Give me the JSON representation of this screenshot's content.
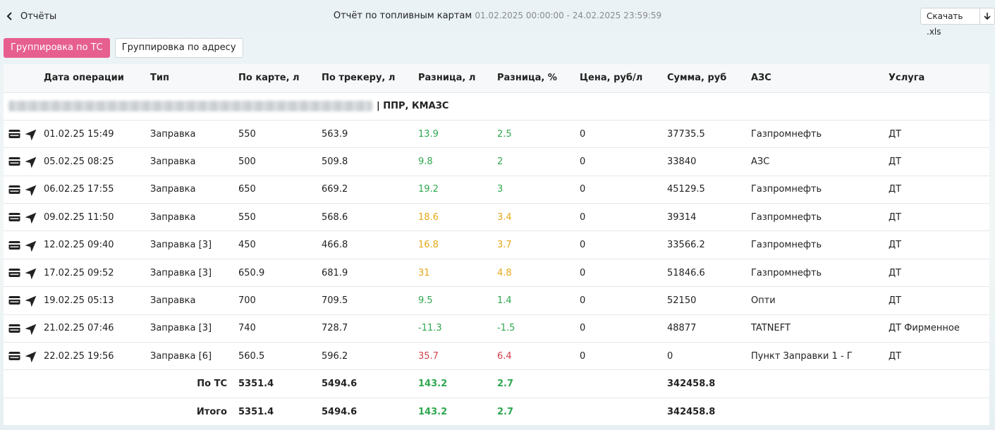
{
  "header": {
    "back_label": "Отчёты",
    "title": "Отчёт по топливным картам",
    "period": "01.02.2025 00:00:00 - 24.02.2025 23:59:59",
    "download_label": "Скачать .xls"
  },
  "tabs": [
    {
      "label": "Группировка по ТС",
      "active": true
    },
    {
      "label": "Группировка по адресу",
      "active": false
    }
  ],
  "table": {
    "columns": [
      "Дата операции",
      "Тип",
      "По карте, л",
      "По трекеру, л",
      "Разница, л",
      "Разница, %",
      "Цена, руб/л",
      "Сумма, руб",
      "АЗС",
      "Услуга"
    ],
    "group_label": "| ППР, КМАЗС",
    "rows": [
      {
        "date": "01.02.25 15:49",
        "type": "Заправка",
        "card": "550",
        "tracker": "563.9",
        "diff_l": "13.9",
        "diff_pct": "2.5",
        "price": "0",
        "sum": "37735.5",
        "station": "Газпромнефть",
        "service": "ДТ",
        "status": "green"
      },
      {
        "date": "05.02.25 08:25",
        "type": "Заправка",
        "card": "500",
        "tracker": "509.8",
        "diff_l": "9.8",
        "diff_pct": "2",
        "price": "0",
        "sum": "33840",
        "station": "АЗС",
        "service": "ДТ",
        "status": "green"
      },
      {
        "date": "06.02.25 17:55",
        "type": "Заправка",
        "card": "650",
        "tracker": "669.2",
        "diff_l": "19.2",
        "diff_pct": "3",
        "price": "0",
        "sum": "45129.5",
        "station": "Газпромнефть",
        "service": "ДТ",
        "status": "green"
      },
      {
        "date": "09.02.25 11:50",
        "type": "Заправка",
        "card": "550",
        "tracker": "568.6",
        "diff_l": "18.6",
        "diff_pct": "3.4",
        "price": "0",
        "sum": "39314",
        "station": "Газпромнефть",
        "service": "ДТ",
        "status": "amber"
      },
      {
        "date": "12.02.25 09:40",
        "type": "Заправка [3]",
        "card": "450",
        "tracker": "466.8",
        "diff_l": "16.8",
        "diff_pct": "3.7",
        "price": "0",
        "sum": "33566.2",
        "station": "Газпромнефть",
        "service": "ДТ",
        "status": "amber"
      },
      {
        "date": "17.02.25 09:52",
        "type": "Заправка [3]",
        "card": "650.9",
        "tracker": "681.9",
        "diff_l": "31",
        "diff_pct": "4.8",
        "price": "0",
        "sum": "51846.6",
        "station": "Газпромнефть",
        "service": "ДТ",
        "status": "amber"
      },
      {
        "date": "19.02.25 05:13",
        "type": "Заправка",
        "card": "700",
        "tracker": "709.5",
        "diff_l": "9.5",
        "diff_pct": "1.4",
        "price": "0",
        "sum": "52150",
        "station": "Опти",
        "service": "ДТ",
        "status": "green"
      },
      {
        "date": "21.02.25 07:46",
        "type": "Заправка [3]",
        "card": "740",
        "tracker": "728.7",
        "diff_l": "-11.3",
        "diff_pct": "-1.5",
        "price": "0",
        "sum": "48877",
        "station": "TATNEFT",
        "service": "ДТ Фирменное",
        "status": "green"
      },
      {
        "date": "22.02.25 19:56",
        "type": "Заправка [6]",
        "card": "560.5",
        "tracker": "596.2",
        "diff_l": "35.7",
        "diff_pct": "6.4",
        "price": "0",
        "sum": "0",
        "station": "Пункт Заправки 1 - Г",
        "service": "ДТ",
        "status": "red"
      }
    ],
    "subtotal": {
      "label": "По ТС",
      "card": "5351.4",
      "tracker": "5494.6",
      "diff_l": "143.2",
      "diff_pct": "2.7",
      "sum": "342458.8"
    },
    "total": {
      "label": "Итого",
      "card": "5351.4",
      "tracker": "5494.6",
      "diff_l": "143.2",
      "diff_pct": "2.7",
      "sum": "342458.8"
    }
  },
  "icons": {
    "back": "chevron-left-icon",
    "download": "arrow-down-icon",
    "card": "card-icon",
    "track": "location-arrow-icon"
  },
  "colors": {
    "accent": "#e65f8e",
    "green": "#2fa84f",
    "amber": "#e6a817",
    "red": "#d23f4a"
  }
}
